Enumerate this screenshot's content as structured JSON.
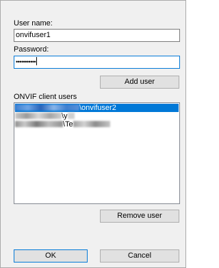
{
  "form": {
    "username_label": "User name:",
    "username_value": "onvifuser1",
    "password_label": "Password:",
    "password_value": "•••••••••••",
    "add_user_label": "Add user"
  },
  "users_list": {
    "label": "ONVIF client users",
    "items": [
      {
        "visible_text": "\\onvifuser2",
        "selected": true
      },
      {
        "visible_text": "\\y",
        "selected": false
      },
      {
        "visible_text": "\\Te",
        "selected": false
      }
    ]
  },
  "remove_user_label": "Remove user",
  "footer": {
    "ok_label": "OK",
    "cancel_label": "Cancel"
  },
  "colors": {
    "dialog_bg": "#f0f0f0",
    "selection": "#0078d7",
    "button_bg": "#e1e1e1"
  }
}
